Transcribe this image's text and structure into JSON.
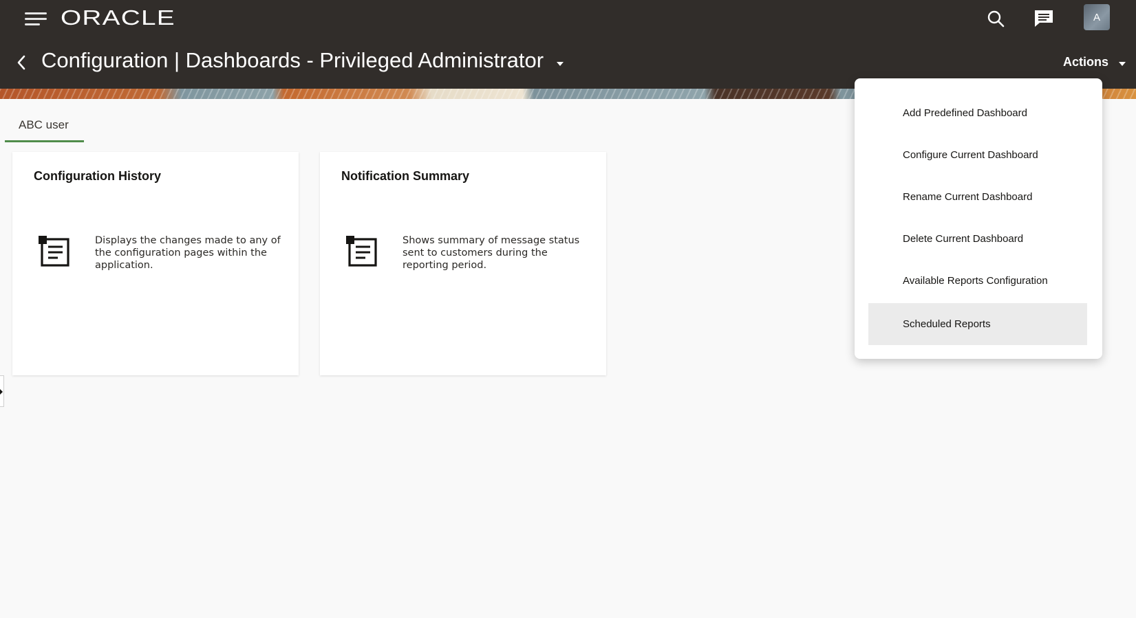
{
  "header": {
    "logo": "ORACLE",
    "page_title": "Configuration |  Dashboards - Privileged Administrator",
    "actions_label": "Actions",
    "avatar_initial": "A"
  },
  "tabs": [
    {
      "label": "ABC user",
      "selected": true
    }
  ],
  "cards": [
    {
      "title": "Configuration History",
      "description": "Displays the changes made to any of the configuration pages within the application."
    },
    {
      "title": "Notification Summary",
      "description": "Shows summary of message status sent to customers during the reporting period."
    }
  ],
  "actions_menu": {
    "items": [
      {
        "label": "Add Predefined Dashboard"
      },
      {
        "label": "Configure Current Dashboard"
      },
      {
        "label": "Rename Current Dashboard"
      },
      {
        "label": "Delete Current Dashboard"
      },
      {
        "label": "Available Reports Configuration"
      },
      {
        "label": "Scheduled Reports",
        "highlighted": true
      }
    ]
  },
  "colors": {
    "header_bg": "#312d2a",
    "tab_underline": "#508c4a",
    "menu_highlight": "#ebebeb"
  },
  "icons": {
    "menu": "hamburger-icon",
    "search": "search-icon",
    "messages": "chat-icon",
    "back": "chevron-left-icon",
    "title_dropdown": "caret-down-icon",
    "card": "report-document-icon"
  }
}
